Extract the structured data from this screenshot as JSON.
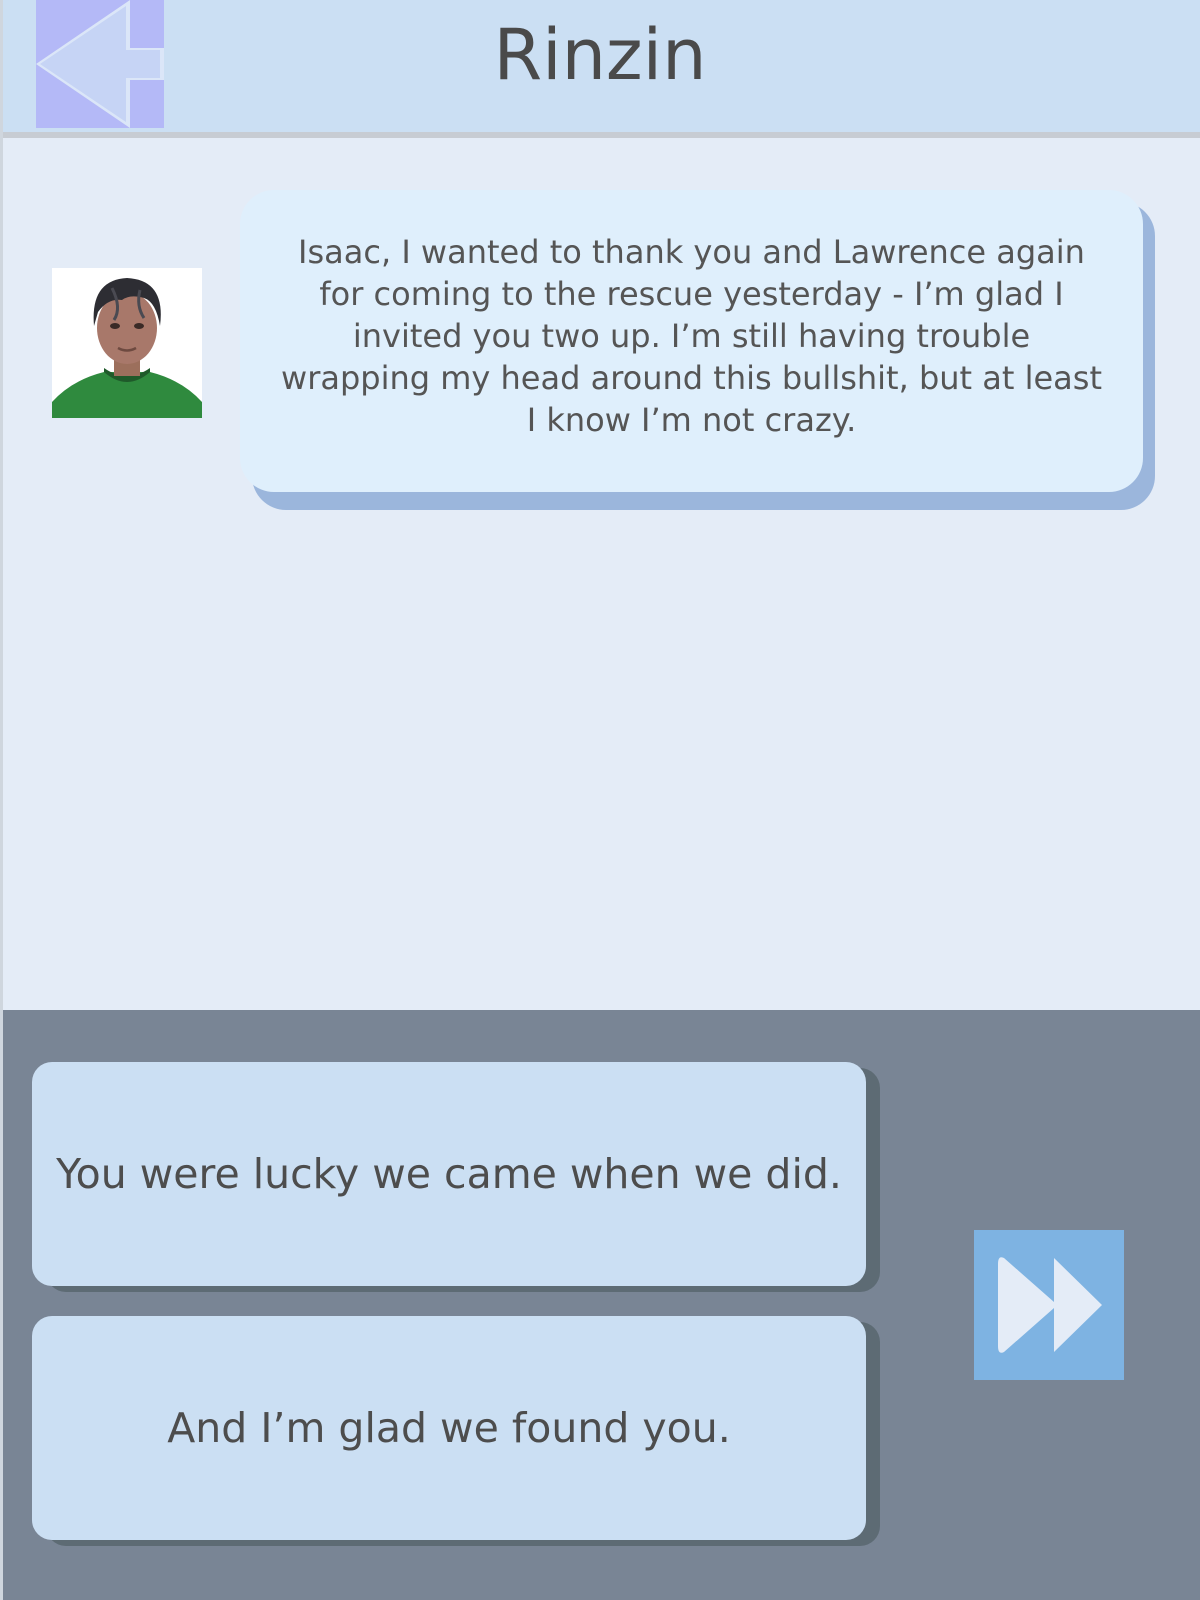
{
  "header": {
    "title": "Rinzin",
    "back_icon": "back-arrow-icon"
  },
  "conversation": {
    "avatar_icon": "character-portrait",
    "message": "Isaac, I wanted to thank you and Lawrence again for coming to the rescue yesterday - I’m glad I invited you two up. I’m still having trouble wrapping my head around this bullshit, but at least I know I’m not crazy."
  },
  "choices": [
    {
      "label": "You were lucky we came when we did."
    },
    {
      "label": "And I’m glad we found you."
    }
  ],
  "controls": {
    "skip_icon": "fast-forward-icon"
  },
  "colors": {
    "header_bg": "#cbdff3",
    "back_button_bg": "#b4b9f7",
    "message_area_bg": "#e4ecf7",
    "bubble_bg": "#dfeffc",
    "bubble_shadow": "#9bb6dc",
    "choices_panel_bg": "#798595",
    "choice_bg": "#cbdff3",
    "skip_button_bg": "#7eb3e2"
  }
}
